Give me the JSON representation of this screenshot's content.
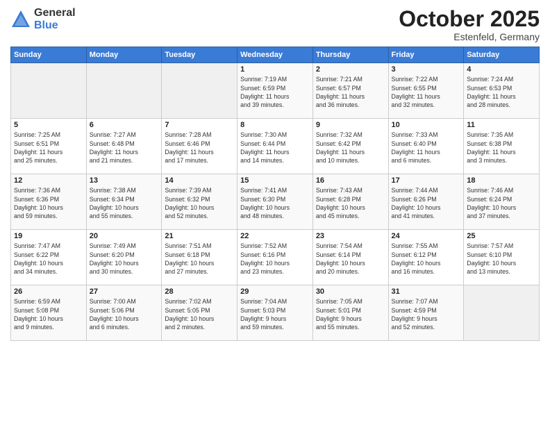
{
  "logo": {
    "general": "General",
    "blue": "Blue"
  },
  "title": "October 2025",
  "subtitle": "Estenfeld, Germany",
  "days_of_week": [
    "Sunday",
    "Monday",
    "Tuesday",
    "Wednesday",
    "Thursday",
    "Friday",
    "Saturday"
  ],
  "weeks": [
    [
      {
        "num": "",
        "info": ""
      },
      {
        "num": "",
        "info": ""
      },
      {
        "num": "",
        "info": ""
      },
      {
        "num": "1",
        "info": "Sunrise: 7:19 AM\nSunset: 6:59 PM\nDaylight: 11 hours\nand 39 minutes."
      },
      {
        "num": "2",
        "info": "Sunrise: 7:21 AM\nSunset: 6:57 PM\nDaylight: 11 hours\nand 36 minutes."
      },
      {
        "num": "3",
        "info": "Sunrise: 7:22 AM\nSunset: 6:55 PM\nDaylight: 11 hours\nand 32 minutes."
      },
      {
        "num": "4",
        "info": "Sunrise: 7:24 AM\nSunset: 6:53 PM\nDaylight: 11 hours\nand 28 minutes."
      }
    ],
    [
      {
        "num": "5",
        "info": "Sunrise: 7:25 AM\nSunset: 6:51 PM\nDaylight: 11 hours\nand 25 minutes."
      },
      {
        "num": "6",
        "info": "Sunrise: 7:27 AM\nSunset: 6:48 PM\nDaylight: 11 hours\nand 21 minutes."
      },
      {
        "num": "7",
        "info": "Sunrise: 7:28 AM\nSunset: 6:46 PM\nDaylight: 11 hours\nand 17 minutes."
      },
      {
        "num": "8",
        "info": "Sunrise: 7:30 AM\nSunset: 6:44 PM\nDaylight: 11 hours\nand 14 minutes."
      },
      {
        "num": "9",
        "info": "Sunrise: 7:32 AM\nSunset: 6:42 PM\nDaylight: 11 hours\nand 10 minutes."
      },
      {
        "num": "10",
        "info": "Sunrise: 7:33 AM\nSunset: 6:40 PM\nDaylight: 11 hours\nand 6 minutes."
      },
      {
        "num": "11",
        "info": "Sunrise: 7:35 AM\nSunset: 6:38 PM\nDaylight: 11 hours\nand 3 minutes."
      }
    ],
    [
      {
        "num": "12",
        "info": "Sunrise: 7:36 AM\nSunset: 6:36 PM\nDaylight: 10 hours\nand 59 minutes."
      },
      {
        "num": "13",
        "info": "Sunrise: 7:38 AM\nSunset: 6:34 PM\nDaylight: 10 hours\nand 55 minutes."
      },
      {
        "num": "14",
        "info": "Sunrise: 7:39 AM\nSunset: 6:32 PM\nDaylight: 10 hours\nand 52 minutes."
      },
      {
        "num": "15",
        "info": "Sunrise: 7:41 AM\nSunset: 6:30 PM\nDaylight: 10 hours\nand 48 minutes."
      },
      {
        "num": "16",
        "info": "Sunrise: 7:43 AM\nSunset: 6:28 PM\nDaylight: 10 hours\nand 45 minutes."
      },
      {
        "num": "17",
        "info": "Sunrise: 7:44 AM\nSunset: 6:26 PM\nDaylight: 10 hours\nand 41 minutes."
      },
      {
        "num": "18",
        "info": "Sunrise: 7:46 AM\nSunset: 6:24 PM\nDaylight: 10 hours\nand 37 minutes."
      }
    ],
    [
      {
        "num": "19",
        "info": "Sunrise: 7:47 AM\nSunset: 6:22 PM\nDaylight: 10 hours\nand 34 minutes."
      },
      {
        "num": "20",
        "info": "Sunrise: 7:49 AM\nSunset: 6:20 PM\nDaylight: 10 hours\nand 30 minutes."
      },
      {
        "num": "21",
        "info": "Sunrise: 7:51 AM\nSunset: 6:18 PM\nDaylight: 10 hours\nand 27 minutes."
      },
      {
        "num": "22",
        "info": "Sunrise: 7:52 AM\nSunset: 6:16 PM\nDaylight: 10 hours\nand 23 minutes."
      },
      {
        "num": "23",
        "info": "Sunrise: 7:54 AM\nSunset: 6:14 PM\nDaylight: 10 hours\nand 20 minutes."
      },
      {
        "num": "24",
        "info": "Sunrise: 7:55 AM\nSunset: 6:12 PM\nDaylight: 10 hours\nand 16 minutes."
      },
      {
        "num": "25",
        "info": "Sunrise: 7:57 AM\nSunset: 6:10 PM\nDaylight: 10 hours\nand 13 minutes."
      }
    ],
    [
      {
        "num": "26",
        "info": "Sunrise: 6:59 AM\nSunset: 5:08 PM\nDaylight: 10 hours\nand 9 minutes."
      },
      {
        "num": "27",
        "info": "Sunrise: 7:00 AM\nSunset: 5:06 PM\nDaylight: 10 hours\nand 6 minutes."
      },
      {
        "num": "28",
        "info": "Sunrise: 7:02 AM\nSunset: 5:05 PM\nDaylight: 10 hours\nand 2 minutes."
      },
      {
        "num": "29",
        "info": "Sunrise: 7:04 AM\nSunset: 5:03 PM\nDaylight: 9 hours\nand 59 minutes."
      },
      {
        "num": "30",
        "info": "Sunrise: 7:05 AM\nSunset: 5:01 PM\nDaylight: 9 hours\nand 55 minutes."
      },
      {
        "num": "31",
        "info": "Sunrise: 7:07 AM\nSunset: 4:59 PM\nDaylight: 9 hours\nand 52 minutes."
      },
      {
        "num": "",
        "info": ""
      }
    ]
  ]
}
